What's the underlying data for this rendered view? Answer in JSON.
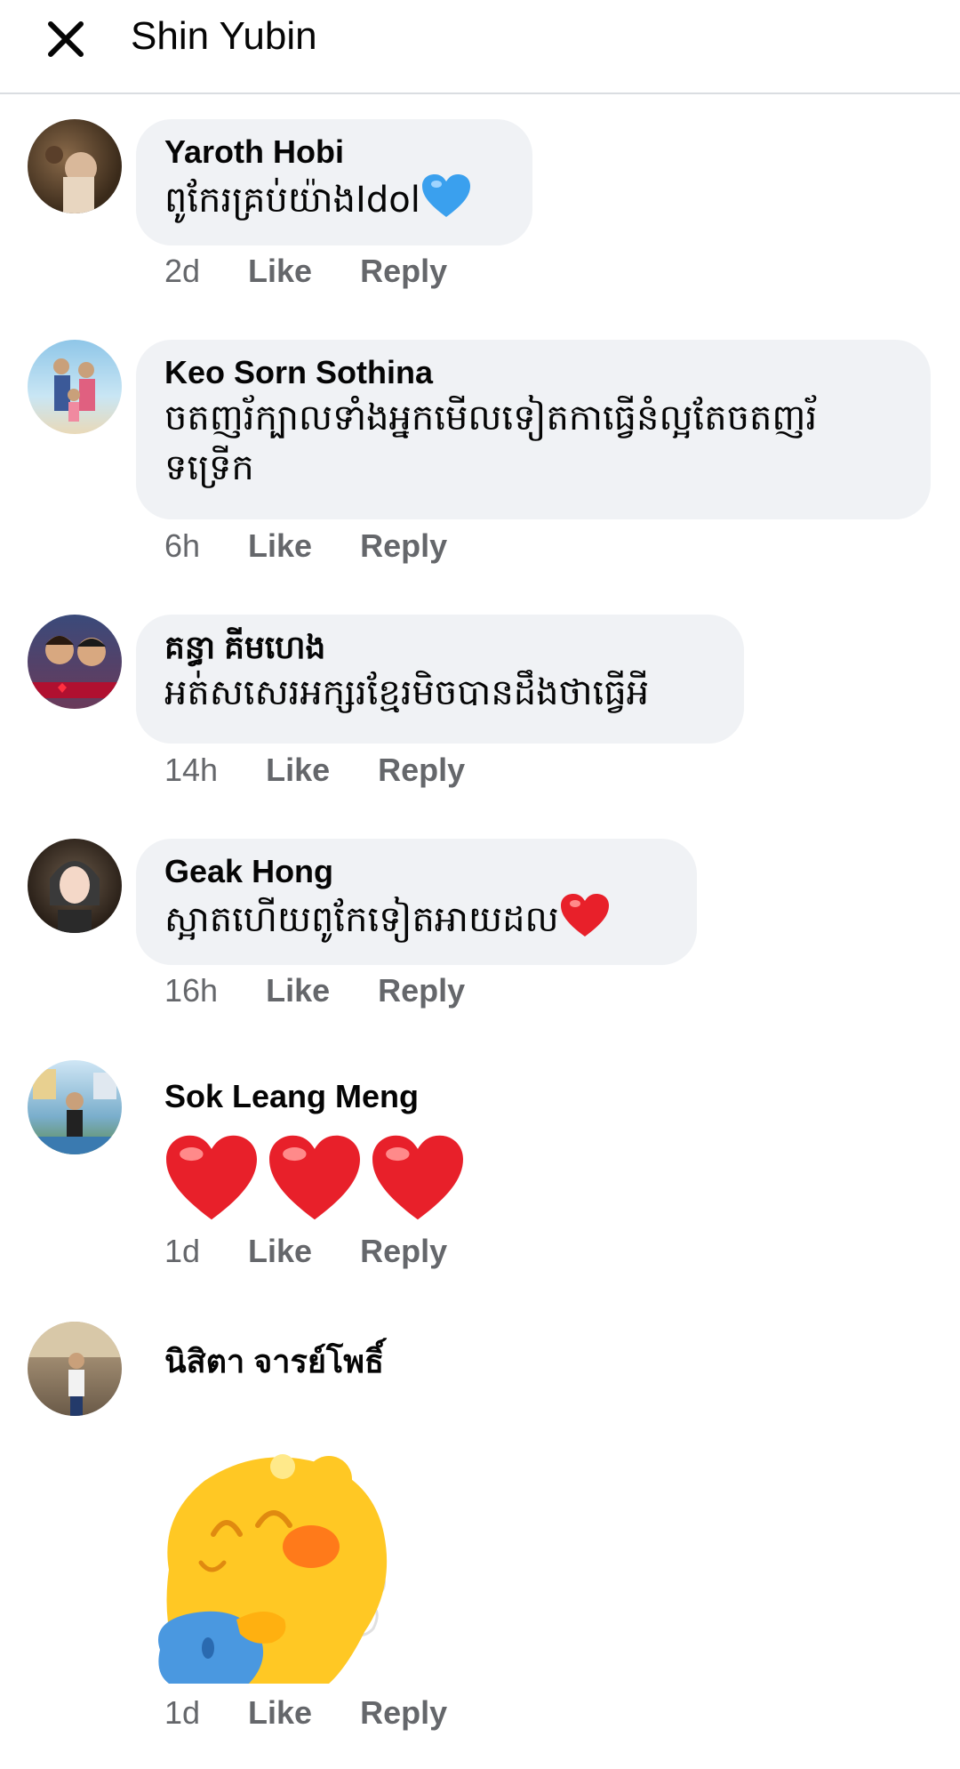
{
  "header": {
    "title": "Shin Yubin"
  },
  "comments": [
    {
      "name": "Yaroth Hobi",
      "text": "ពូកែរគ្រប់យ៉ាងIdol",
      "time": "2d",
      "like": "Like",
      "reply": "Reply",
      "emoji": "blue-heart"
    },
    {
      "name": "Keo Sorn Sothina",
      "text_line1": "ចតញរ័ក្បាលទាំងអ្នកមើលទៀតកាធ្វើនំល្អតែចតញរ័",
      "text_line2": "ទទ្រើក",
      "time": "6h",
      "like": "Like",
      "reply": "Reply"
    },
    {
      "name": "គន្ធា គីមហេង",
      "text": "អត់សសេរអក្សរខ្មែរមិចបានដឹងថាធ្វើអី",
      "time": "14h",
      "like": "Like",
      "reply": "Reply"
    },
    {
      "name": "Geak Hong",
      "text": "ស្អាតហើយពូកែទៀតអាយដល",
      "time": "16h",
      "like": "Like",
      "reply": "Reply",
      "emoji": "red-heart"
    },
    {
      "name": "Sok Leang Meng",
      "time": "1d",
      "like": "Like",
      "reply": "Reply",
      "emoji": "three-red-hearts"
    },
    {
      "name": "นิสิตา จารย์โพธิ์",
      "time": "1d",
      "like": "Like",
      "reply": "Reply",
      "sticker": "yellow-bear-sticker"
    }
  ],
  "colors": {
    "bubble": "#f0f2f5",
    "meta": "#65676b",
    "text": "#050505",
    "heart_red": "#e8202a",
    "heart_blue": "#3aa0ee",
    "sticker_yellow": "#ffc824"
  }
}
